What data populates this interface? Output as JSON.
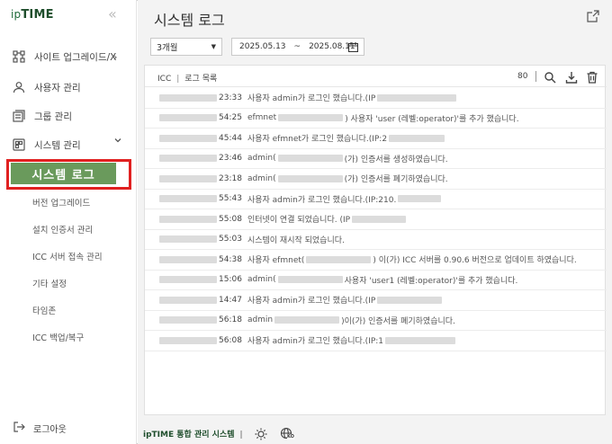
{
  "brand": {
    "prefix": "ip",
    "name": "TIME",
    "collapse_glyph": "«"
  },
  "sidebar": {
    "items": [
      {
        "label": "사이트 업그레이드/X",
        "icon": "sitemap-icon",
        "chevron": "›"
      },
      {
        "label": "사용자 관리",
        "icon": "user-icon"
      },
      {
        "label": "그룹 관리",
        "icon": "group-icon"
      },
      {
        "label": "시스템 관리",
        "icon": "system-icon",
        "chevron": "⌄"
      }
    ],
    "active_label": "시스템 로그",
    "sub_items": [
      "버전 업그레이드",
      "설치 인증서 관리",
      "ICC 서버 접속 관리",
      "기타 설정",
      "타임존",
      "ICC 백업/복구"
    ],
    "logout": "로그아웃"
  },
  "header": {
    "title": "시스템 로그"
  },
  "filters": {
    "period": "3개월",
    "date_from": "2025.05.13",
    "date_sep": "~",
    "date_to": "2025.08.11"
  },
  "panel": {
    "crumb_root": "ICC",
    "crumb_sep": "|",
    "crumb_page": "로그 목록",
    "count": "80"
  },
  "logs": [
    {
      "time": "23:33",
      "pre": "",
      "post": "사용자 admin가 로그인 했습니다.(IP"
    },
    {
      "time": "54:25",
      "pre": "efmnet",
      "post": ") 사용자 'user (레벨:operator)'를 추가 했습니다."
    },
    {
      "time": "45:44",
      "pre": "",
      "post": "사용자 efmnet가 로그인 했습니다.(IP:2"
    },
    {
      "time": "23:46",
      "pre": "admin(",
      "post": "(가) 인증서를 생성하였습니다."
    },
    {
      "time": "23:18",
      "pre": "admin(",
      "post": "(가) 인증서를 폐기하였습니다."
    },
    {
      "time": "55:43",
      "pre": "",
      "post": "사용자  admin가 로그인 했습니다.(IP:210."
    },
    {
      "time": "55:08",
      "pre": "",
      "post": "인터넷이 연결 되었습니다. (IP"
    },
    {
      "time": "55:03",
      "pre": "",
      "post": "시스템이 재시작 되었습니다."
    },
    {
      "time": "54:38",
      "pre": "사용자 efmnet(",
      "post": ") 이(가) ICC 서버를 0.90.6 버전으로 업데이트 하였습니다."
    },
    {
      "time": "15:06",
      "pre": "admin(",
      "post": "사용자 'user1 (레벨:operator)'를 추가 했습니다."
    },
    {
      "time": "14:47",
      "pre": "",
      "post": "사용자 admin가 로그인 했습니다.(IP"
    },
    {
      "time": "56:18",
      "pre": "admin",
      "post": ")이(가) 인증서를 폐기하였습니다."
    },
    {
      "time": "56:08",
      "pre": "",
      "post": "사용자 admin가 로그인 했습니다.(IP:1"
    }
  ],
  "footer": {
    "brand": "ipTIME 통합 관리 시스템",
    "sep": "|",
    "lang_badge": "KO"
  },
  "colors": {
    "active_bg": "#6a9a5c",
    "highlight": "#e02020",
    "brand": "#1f4e2c"
  }
}
